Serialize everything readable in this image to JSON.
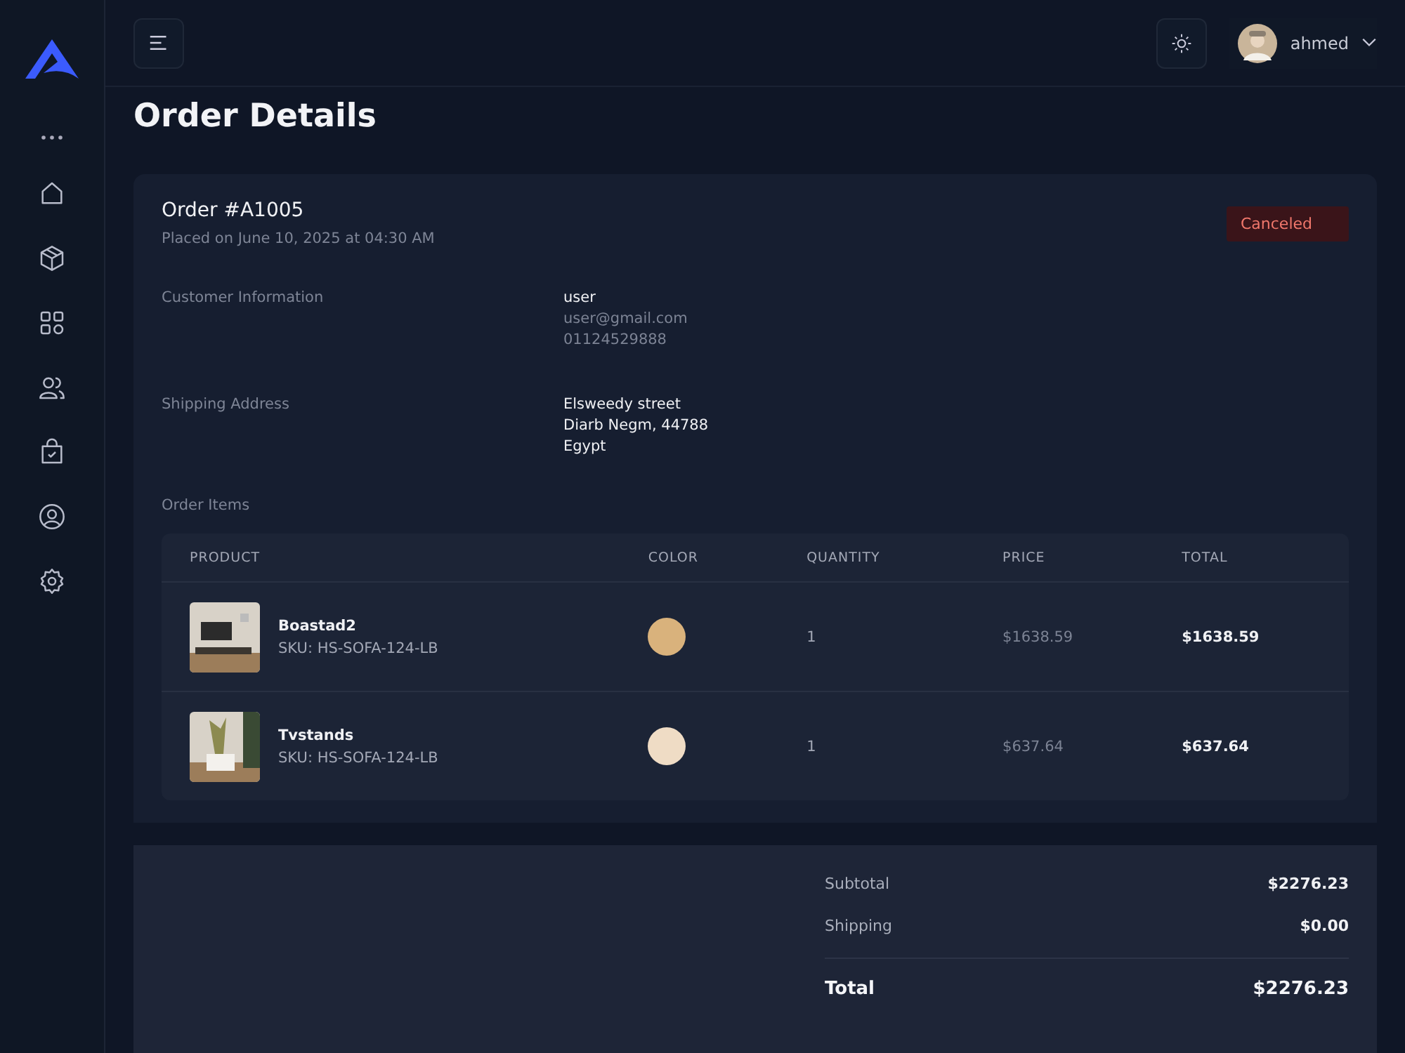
{
  "header": {
    "user_name": "ahmed"
  },
  "page_title": "Order Details",
  "order": {
    "title": "Order #A1005",
    "placed": "Placed on June 10, 2025 at 04:30 AM",
    "status": "Canceled"
  },
  "customer": {
    "label": "Customer Information",
    "name": "user",
    "email": "user@gmail.com",
    "phone": "01124529888"
  },
  "shipping": {
    "label": "Shipping Address",
    "lines": [
      "Elsweedy street",
      "Diarb Negm, 44788",
      "Egypt"
    ]
  },
  "items_label": "Order Items",
  "table": {
    "columns": [
      "PRODUCT",
      "COLOR",
      "QUANTITY",
      "PRICE",
      "TOTAL"
    ],
    "rows": [
      {
        "name": "Boastad2",
        "sku": "SKU: HS-SOFA-124-LB",
        "color": "#d9b27c",
        "quantity": "1",
        "price": "$1638.59",
        "total": "$1638.59"
      },
      {
        "name": "Tvstands",
        "sku": "SKU: HS-SOFA-124-LB",
        "color": "#efdcc5",
        "quantity": "1",
        "price": "$637.64",
        "total": "$637.64"
      }
    ]
  },
  "summary": [
    {
      "label": "Subtotal",
      "value": "$2276.23",
      "kind": "line"
    },
    {
      "label": "Shipping",
      "value": "$0.00",
      "kind": "line"
    },
    {
      "label": "Total",
      "value": "$2276.23",
      "kind": "total"
    }
  ]
}
